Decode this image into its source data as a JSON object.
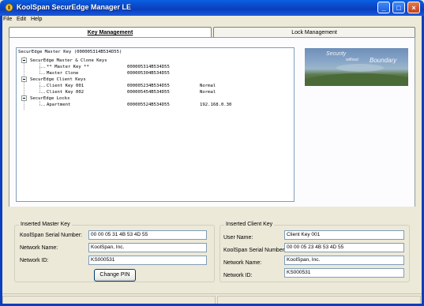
{
  "window": {
    "title": "KoolSpan SecurEdge Manager LE"
  },
  "menu": [
    "File",
    "Edit",
    "Help"
  ],
  "tabs": [
    {
      "label": "Key Management",
      "active": true
    },
    {
      "label": "Lock Management",
      "active": false
    }
  ],
  "tree": {
    "root": "SecurEdge Master Key (000005314B534D55)",
    "groups": [
      {
        "label": "SecurEdge Master & Clone Keys",
        "items": [
          {
            "name": "** Master Key **",
            "serial": "000005314B534D55",
            "status": ""
          },
          {
            "name": "Master Clone",
            "serial": "000005304B534D55",
            "status": ""
          }
        ]
      },
      {
        "label": "SecurEdge Client Keys",
        "items": [
          {
            "name": "Client Key 001",
            "serial": "000005234B534D55",
            "status": "Normal"
          },
          {
            "name": "Client Key 002",
            "serial": "000005454B534D55",
            "status": "Normal"
          }
        ]
      },
      {
        "label": "SecurEdge Locks",
        "items": [
          {
            "name": "Apartment",
            "serial": "000005524B534D55",
            "status": "192.168.0.30"
          }
        ]
      }
    ]
  },
  "banner": {
    "line1": "Security",
    "line2": "without",
    "line3": "Boundary"
  },
  "master_panel": {
    "title": "Inserted Master Key",
    "serial_label": "KoolSpan Serial Number:",
    "serial_value": "00 00 05 31 4B 53 4D 55",
    "network_name_label": "Network Name:",
    "network_name_value": "KoolSpan, Inc.",
    "network_id_label": "Network ID:",
    "network_id_value": "KS000531",
    "change_pin_label": "Change PIN"
  },
  "client_panel": {
    "title": "Inserted Client Key",
    "user_label": "User Name:",
    "user_value": "Client Key 001",
    "serial_label": "KoolSpan Serial Number:",
    "serial_value": "00 00 05 23 4B 53 4D 55",
    "network_name_label": "Network Name:",
    "network_name_value": "KoolSpan, Inc.",
    "network_id_label": "Network ID:",
    "network_id_value": "KS000531"
  },
  "colors": {
    "titlebar": "#0A48C8",
    "window_bg": "#ECE9D8"
  }
}
